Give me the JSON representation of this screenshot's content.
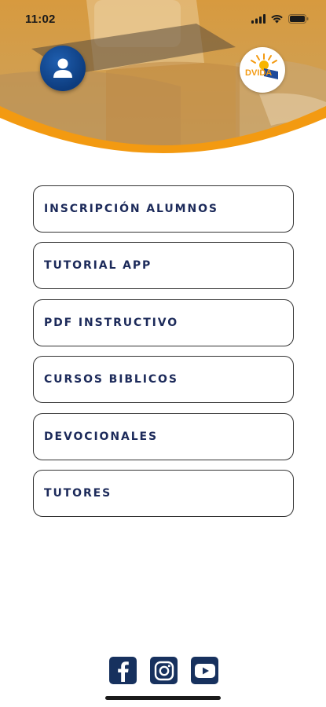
{
  "status": {
    "time": "11:02",
    "icons": [
      "signal-icon",
      "wifi-icon",
      "battery-icon"
    ]
  },
  "header": {
    "avatar_icon": "user-icon",
    "logo_text": "DVIDA"
  },
  "menu": {
    "items": [
      {
        "label": "INSCRIPCIÓN ALUMNOS"
      },
      {
        "label": "TUTORIAL APP"
      },
      {
        "label": "PDF INSTRUCTIVO"
      },
      {
        "label": "CURSOS BIBLICOS"
      },
      {
        "label": "DEVOCIONALES"
      },
      {
        "label": "TUTORES"
      }
    ]
  },
  "footer": {
    "social": [
      "facebook-icon",
      "instagram-icon",
      "youtube-icon"
    ]
  },
  "colors": {
    "accent_orange": "#f39a11",
    "navy": "#17315e",
    "text_navy": "#1c2a5a"
  }
}
